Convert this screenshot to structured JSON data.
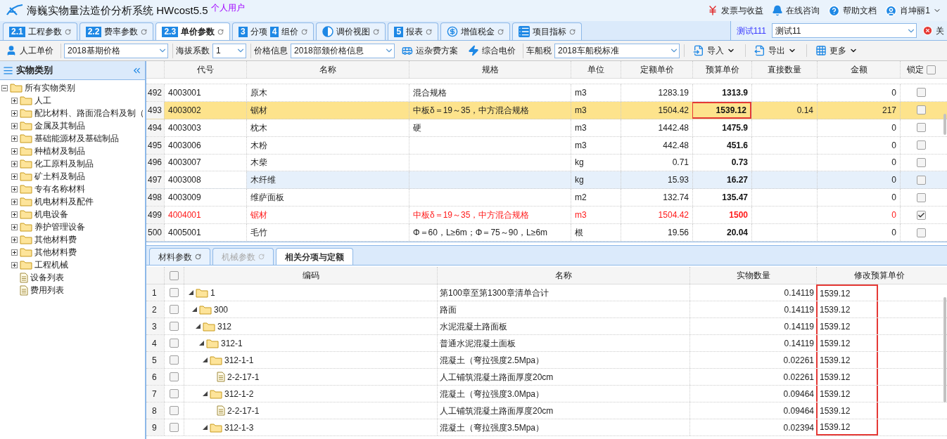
{
  "app": {
    "title": "海巍实物量法造价分析系统 HWcost5.5",
    "badge": "个人用户"
  },
  "header_links": [
    {
      "kind": "money",
      "label": "发票与收益"
    },
    {
      "kind": "bell",
      "label": "在线咨询"
    },
    {
      "kind": "help",
      "label": "帮助文档"
    },
    {
      "kind": "user",
      "label": "肖坤丽1"
    }
  ],
  "tabs": [
    {
      "badges": [
        "2.1"
      ],
      "label": "工程参数",
      "selected": false
    },
    {
      "badges": [
        "2.2"
      ],
      "label": "费率参数",
      "selected": false
    },
    {
      "badges": [
        "2.3"
      ],
      "label": "单价参数",
      "selected": true
    },
    {
      "badges": [
        "3",
        "4"
      ],
      "label": "分项",
      "label_2": "组价",
      "selected": false
    },
    {
      "kind": "contrast",
      "label": "调价视图",
      "selected": false
    },
    {
      "badges": [
        "5"
      ],
      "label": "报表",
      "selected": false
    },
    {
      "kind": "coin",
      "label": "增值税金",
      "selected": false
    },
    {
      "kind": "list",
      "label": "项目指标",
      "selected": false
    }
  ],
  "project": {
    "label": "测试111",
    "value": "测试11",
    "close": "关"
  },
  "toolbar": [
    {
      "kind": "person",
      "label": "人工单价"
    },
    {
      "kind": "select",
      "value": "2018基期价格"
    },
    {
      "kind": "select",
      "label": "海拔系数",
      "value": "1"
    },
    {
      "kind": "select",
      "label": "价格信息",
      "value": "2018部颁价格信息"
    },
    {
      "kind": "bus",
      "label": "运杂费方案"
    },
    {
      "kind": "bolt",
      "label": "综合电价"
    },
    {
      "kind": "select",
      "label": "车船税",
      "value": "2018车船税标准"
    },
    {
      "kind": "import",
      "label": "导入"
    },
    {
      "kind": "export",
      "label": "导出"
    },
    {
      "kind": "grid",
      "label": "更多"
    }
  ],
  "sidebar": {
    "title": "实物类别",
    "tree": [
      {
        "label": "所有实物类别",
        "kind": "folder",
        "expanded": true,
        "children": [
          {
            "label": "人工",
            "kind": "folder",
            "expanded": false
          },
          {
            "label": "配比材料、路面混合料及制（",
            "kind": "folder",
            "expanded": false
          },
          {
            "label": "金属及其制品",
            "kind": "folder",
            "expanded": false
          },
          {
            "label": "基础能源材及基础制品",
            "kind": "folder",
            "expanded": false
          },
          {
            "label": "种植材及制品",
            "kind": "folder",
            "expanded": false
          },
          {
            "label": "化工原料及制品",
            "kind": "folder",
            "expanded": false
          },
          {
            "label": "矿土料及制品",
            "kind": "folder",
            "expanded": false
          },
          {
            "label": "专有名称材料",
            "kind": "folder",
            "expanded": false
          },
          {
            "label": "机电材料及配件",
            "kind": "folder",
            "expanded": false
          },
          {
            "label": "机电设备",
            "kind": "folder",
            "expanded": false
          },
          {
            "label": "养护管理设备",
            "kind": "folder",
            "expanded": false
          },
          {
            "label": "其他材料费",
            "kind": "folder",
            "expanded": false
          },
          {
            "label": "其他材料费",
            "kind": "folder",
            "expanded": false
          },
          {
            "label": "工程机械",
            "kind": "folder",
            "expanded": false
          },
          {
            "label": "设备列表",
            "kind": "file"
          },
          {
            "label": "费用列表",
            "kind": "file"
          }
        ]
      }
    ]
  },
  "price_table": {
    "columns": [
      "代号",
      "名称",
      "规格",
      "单位",
      "定额单价",
      "预算单价",
      "直接数量",
      "金额",
      "锁定"
    ],
    "lock_all_checked": false,
    "rows": [
      {
        "num": "492",
        "code": "4003001",
        "name": "原木",
        "spec": "混合规格",
        "unit": "m3",
        "quota_price": "1283.19",
        "budget_price": "1313.9",
        "direct_qty": "",
        "amount": "0",
        "locked": false,
        "selected": false,
        "hovered": false,
        "modified": false,
        "outlined": false
      },
      {
        "num": "493",
        "code": "4003002",
        "name": "锯材",
        "spec": "中板δ＝19～35，中方混合规格",
        "unit": "m3",
        "quota_price": "1504.42",
        "budget_price": "1539.12",
        "direct_qty": "0.14",
        "amount": "217",
        "locked": false,
        "selected": true,
        "hovered": false,
        "modified": false,
        "outlined": true
      },
      {
        "num": "494",
        "code": "4003003",
        "name": "枕木",
        "spec": "硬",
        "unit": "m3",
        "quota_price": "1442.48",
        "budget_price": "1475.9",
        "direct_qty": "",
        "amount": "0",
        "locked": false,
        "selected": false,
        "hovered": false,
        "modified": false,
        "outlined": false
      },
      {
        "num": "495",
        "code": "4003006",
        "name": "木粉",
        "spec": "",
        "unit": "m3",
        "quota_price": "442.48",
        "budget_price": "451.6",
        "direct_qty": "",
        "amount": "0",
        "locked": false,
        "selected": false,
        "hovered": false,
        "modified": false,
        "outlined": false
      },
      {
        "num": "496",
        "code": "4003007",
        "name": "木柴",
        "spec": "",
        "unit": "kg",
        "quota_price": "0.71",
        "budget_price": "0.73",
        "direct_qty": "",
        "amount": "0",
        "locked": false,
        "selected": false,
        "hovered": false,
        "modified": false,
        "outlined": false
      },
      {
        "num": "497",
        "code": "4003008",
        "name": "木纤维",
        "spec": "",
        "unit": "kg",
        "quota_price": "15.93",
        "budget_price": "16.27",
        "direct_qty": "",
        "amount": "0",
        "locked": false,
        "selected": false,
        "hovered": true,
        "modified": false,
        "outlined": false
      },
      {
        "num": "498",
        "code": "4003009",
        "name": "维萨面板",
        "spec": "",
        "unit": "m2",
        "quota_price": "132.74",
        "budget_price": "135.47",
        "direct_qty": "",
        "amount": "0",
        "locked": false,
        "selected": false,
        "hovered": false,
        "modified": false,
        "outlined": false
      },
      {
        "num": "499",
        "code": "4004001",
        "name": "锯材",
        "spec": "中板δ＝19～35，中方混合规格",
        "unit": "m3",
        "quota_price": "1504.42",
        "budget_price": "1500",
        "direct_qty": "",
        "amount": "0",
        "locked": true,
        "selected": false,
        "hovered": false,
        "modified": true,
        "outlined": false
      },
      {
        "num": "500",
        "code": "4005001",
        "name": "毛竹",
        "spec": "Φ＝60，L≥6m；Φ＝75～90，L≥6m",
        "unit": "根",
        "quota_price": "19.56",
        "budget_price": "20.04",
        "direct_qty": "",
        "amount": "0",
        "locked": false,
        "selected": false,
        "hovered": false,
        "modified": false,
        "outlined": false
      }
    ]
  },
  "bottom_tabs": [
    {
      "label": "材料参数",
      "selected": false,
      "disabled": false,
      "refresh": true
    },
    {
      "label": "机械参数",
      "selected": false,
      "disabled": true,
      "refresh": true
    },
    {
      "label": "相关分项与定额",
      "selected": true,
      "disabled": false,
      "refresh": false
    }
  ],
  "usage_table": {
    "columns": [
      "编码",
      "名称",
      "实物数量",
      "修改预算单价"
    ],
    "price_outlined": true,
    "all_checked": false,
    "tree": [
      {
        "num": "1",
        "code": "1",
        "name": "第100章至第1300章清单合计",
        "qty": "0.14119",
        "price": "1539.12",
        "kind": "folder",
        "expanded": true,
        "checked": false,
        "children": [
          {
            "num": "2",
            "code": "300",
            "name": "路面",
            "qty": "0.14119",
            "price": "1539.12",
            "kind": "folder",
            "expanded": true,
            "checked": false,
            "children": [
              {
                "num": "3",
                "code": "312",
                "name": "水泥混凝土路面板",
                "qty": "0.14119",
                "price": "1539.12",
                "kind": "folder",
                "expanded": true,
                "checked": false,
                "children": [
                  {
                    "num": "4",
                    "code": "312-1",
                    "name": "普通水泥混凝土面板",
                    "qty": "0.14119",
                    "price": "1539.12",
                    "kind": "folder",
                    "expanded": true,
                    "checked": false,
                    "children": [
                      {
                        "num": "5",
                        "code": "312-1-1",
                        "name": "混凝土（弯拉强度2.5Mpa）",
                        "qty": "0.02261",
                        "price": "1539.12",
                        "kind": "folder",
                        "expanded": true,
                        "checked": false,
                        "children": [
                          {
                            "num": "6",
                            "code": "2-2-17-1",
                            "name": "人工铺筑混凝土路面厚度20cm",
                            "qty": "0.02261",
                            "price": "1539.12",
                            "kind": "item",
                            "checked": false
                          }
                        ]
                      },
                      {
                        "num": "7",
                        "code": "312-1-2",
                        "name": "混凝土（弯拉强度3.0Mpa）",
                        "qty": "0.09464",
                        "price": "1539.12",
                        "kind": "folder",
                        "expanded": true,
                        "checked": false,
                        "children": [
                          {
                            "num": "8",
                            "code": "2-2-17-1",
                            "name": "人工铺筑混凝土路面厚度20cm",
                            "qty": "0.09464",
                            "price": "1539.12",
                            "kind": "item",
                            "checked": false
                          }
                        ]
                      },
                      {
                        "num": "9",
                        "code": "312-1-3",
                        "name": "混凝土（弯拉强度3.5Mpa）",
                        "qty": "0.02394",
                        "price": "1539.12",
                        "kind": "folder",
                        "expanded": true,
                        "checked": false
                      }
                    ]
                  }
                ]
              }
            ]
          }
        ]
      }
    ]
  }
}
